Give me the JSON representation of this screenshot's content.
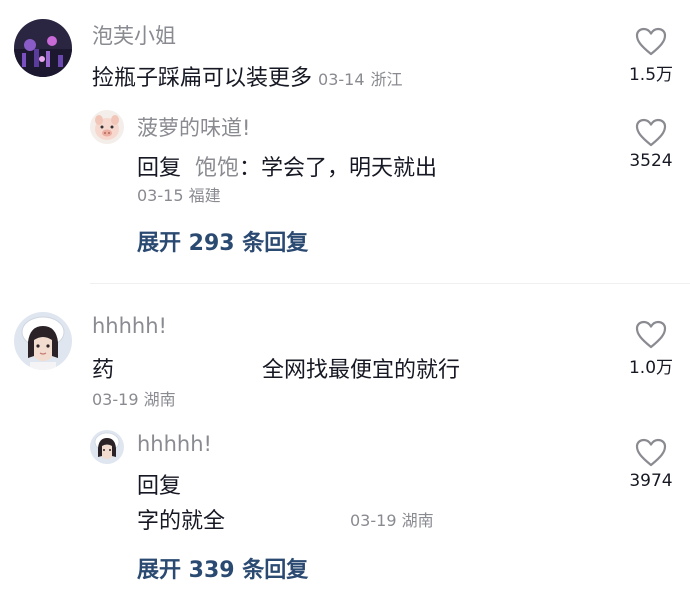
{
  "comments": [
    {
      "author": "泡芙小姐",
      "text": "捡瓶子踩扁可以装更多",
      "date": "03-14",
      "location": "浙江",
      "likes": "1.5万",
      "replies": [
        {
          "author": "菠萝的味道!",
          "prefix": "回复",
          "target": "饱饱",
          "text": "：学会了，明天就出",
          "date": "03-15",
          "location": "福建",
          "likes": "3524"
        }
      ],
      "expand_label": "展开 293 条回复"
    },
    {
      "author": "hhhhh!",
      "text_start": "药",
      "text_end": "全网找最便宜的就行",
      "date": "03-19",
      "location": "湖南",
      "likes": "1.0万",
      "replies": [
        {
          "author": "hhhhh!",
          "prefix": "回复",
          "text_line2": "字的就全",
          "date": "03-19",
          "location": "湖南",
          "likes": "3974"
        }
      ],
      "expand_label": "展开 339 条回复"
    }
  ],
  "icons": {
    "like": "heart-outline-icon"
  },
  "colors": {
    "text": "#161823",
    "secondary": "#8a8b91",
    "link": "#2b4a72"
  }
}
